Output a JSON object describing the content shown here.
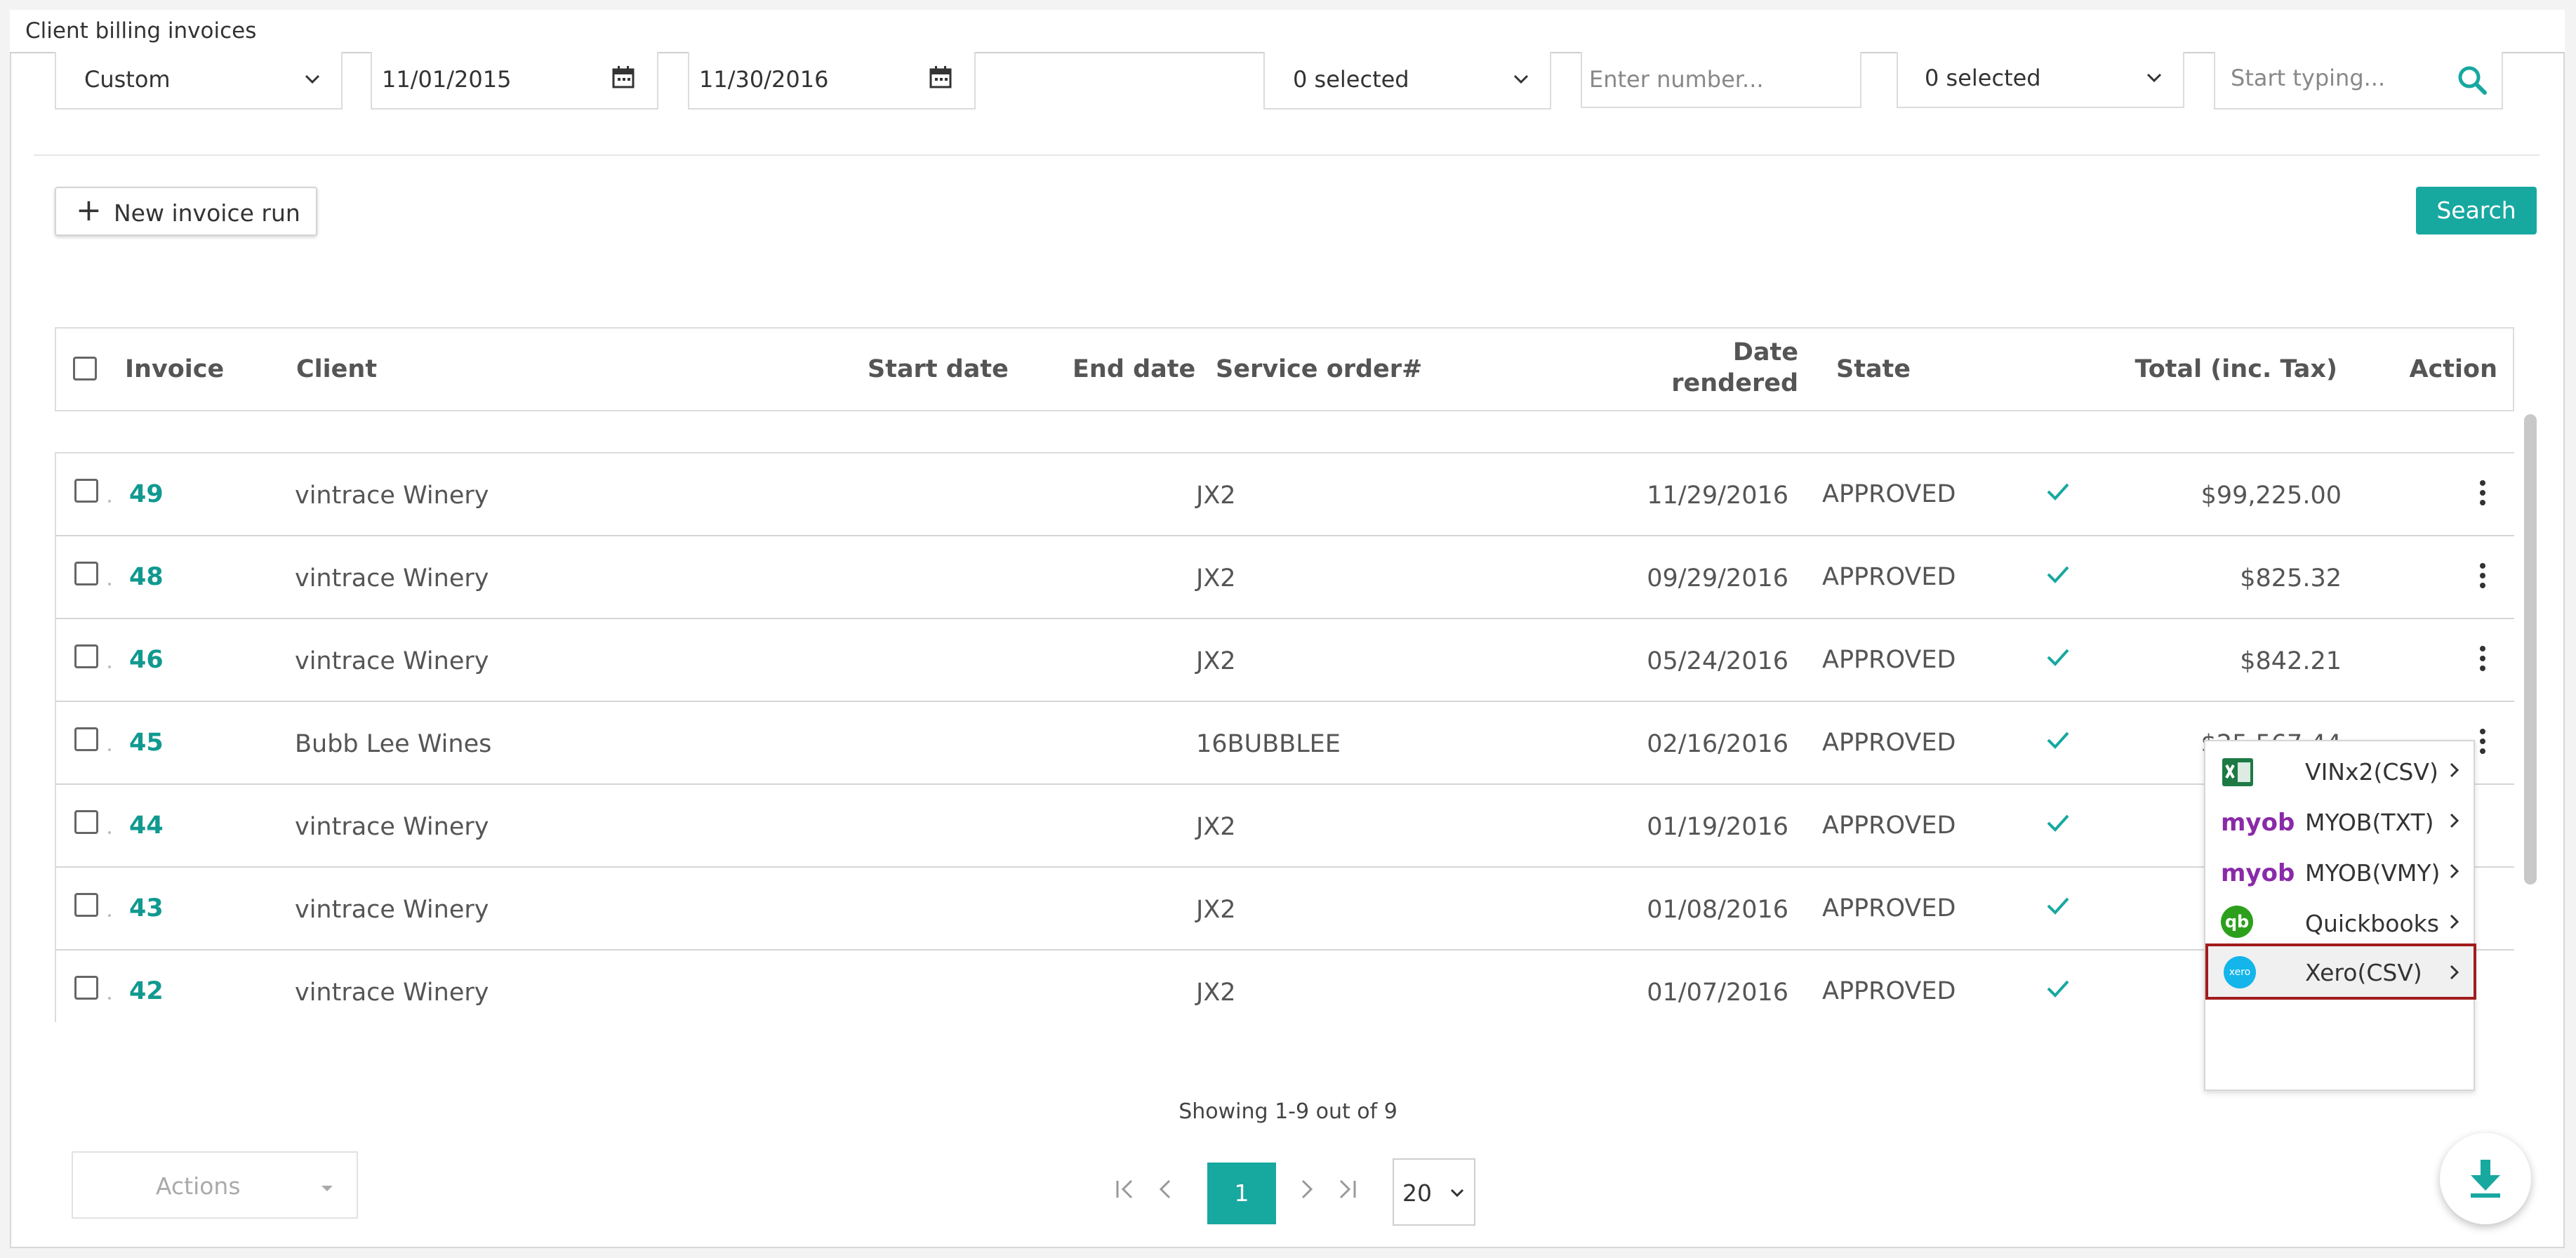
{
  "window": {
    "title": "Client billing invoices"
  },
  "filters": {
    "period": "Custom",
    "start_date": "11/01/2015",
    "end_date": "11/30/2016",
    "select_a": "0 selected",
    "number_placeholder": "Enter number...",
    "select_b": "0 selected",
    "search_placeholder": "Start typing..."
  },
  "toolbar": {
    "new_invoice_run": "New invoice run",
    "search": "Search"
  },
  "table": {
    "headers": {
      "invoice": "Invoice",
      "client": "Client",
      "start_date": "Start date",
      "end_date": "End date",
      "service_order": "Service order#",
      "date_rendered_1": "Date",
      "date_rendered_2": "rendered",
      "state": "State",
      "total": "Total (inc. Tax)",
      "action": "Action"
    },
    "rows": [
      {
        "invoice": "49",
        "client": "vintrace Winery",
        "service_order": "JX2",
        "date_rendered": "11/29/2016",
        "state": "APPROVED",
        "total": "$99,225.00"
      },
      {
        "invoice": "48",
        "client": "vintrace Winery",
        "service_order": "JX2",
        "date_rendered": "09/29/2016",
        "state": "APPROVED",
        "total": "$825.32"
      },
      {
        "invoice": "46",
        "client": "vintrace Winery",
        "service_order": "JX2",
        "date_rendered": "05/24/2016",
        "state": "APPROVED",
        "total": "$842.21"
      },
      {
        "invoice": "45",
        "client": "Bubb Lee Wines",
        "service_order": "16BUBBLEE",
        "date_rendered": "02/16/2016",
        "state": "APPROVED",
        "total": "$25,567.44"
      },
      {
        "invoice": "44",
        "client": "vintrace Winery",
        "service_order": "JX2",
        "date_rendered": "01/19/2016",
        "state": "APPROVED",
        "total": ""
      },
      {
        "invoice": "43",
        "client": "vintrace Winery",
        "service_order": "JX2",
        "date_rendered": "01/08/2016",
        "state": "APPROVED",
        "total": ""
      },
      {
        "invoice": "42",
        "client": "vintrace Winery",
        "service_order": "JX2",
        "date_rendered": "01/07/2016",
        "state": "APPROVED",
        "total": ""
      }
    ]
  },
  "export_menu": {
    "items": [
      {
        "label": "VINx2(CSV)",
        "icon": "excel-icon"
      },
      {
        "label": "MYOB(TXT)",
        "icon": "myob-logo"
      },
      {
        "label": "MYOB(VMY)",
        "icon": "myob-logo"
      },
      {
        "label": "Quickbooks",
        "icon": "quickbooks-logo"
      },
      {
        "label": "Xero(CSV)",
        "icon": "xero-logo",
        "highlighted": true
      }
    ],
    "myob_text": "myob",
    "qb_text": "qb",
    "xero_text": "xero"
  },
  "pagination": {
    "showing": "Showing 1-9 out of 9",
    "current_page": "1",
    "page_size": "20"
  },
  "footer": {
    "actions": "Actions"
  },
  "colors": {
    "accent": "#17a8a0",
    "link": "#119990",
    "highlight_border": "#a11c1c"
  }
}
